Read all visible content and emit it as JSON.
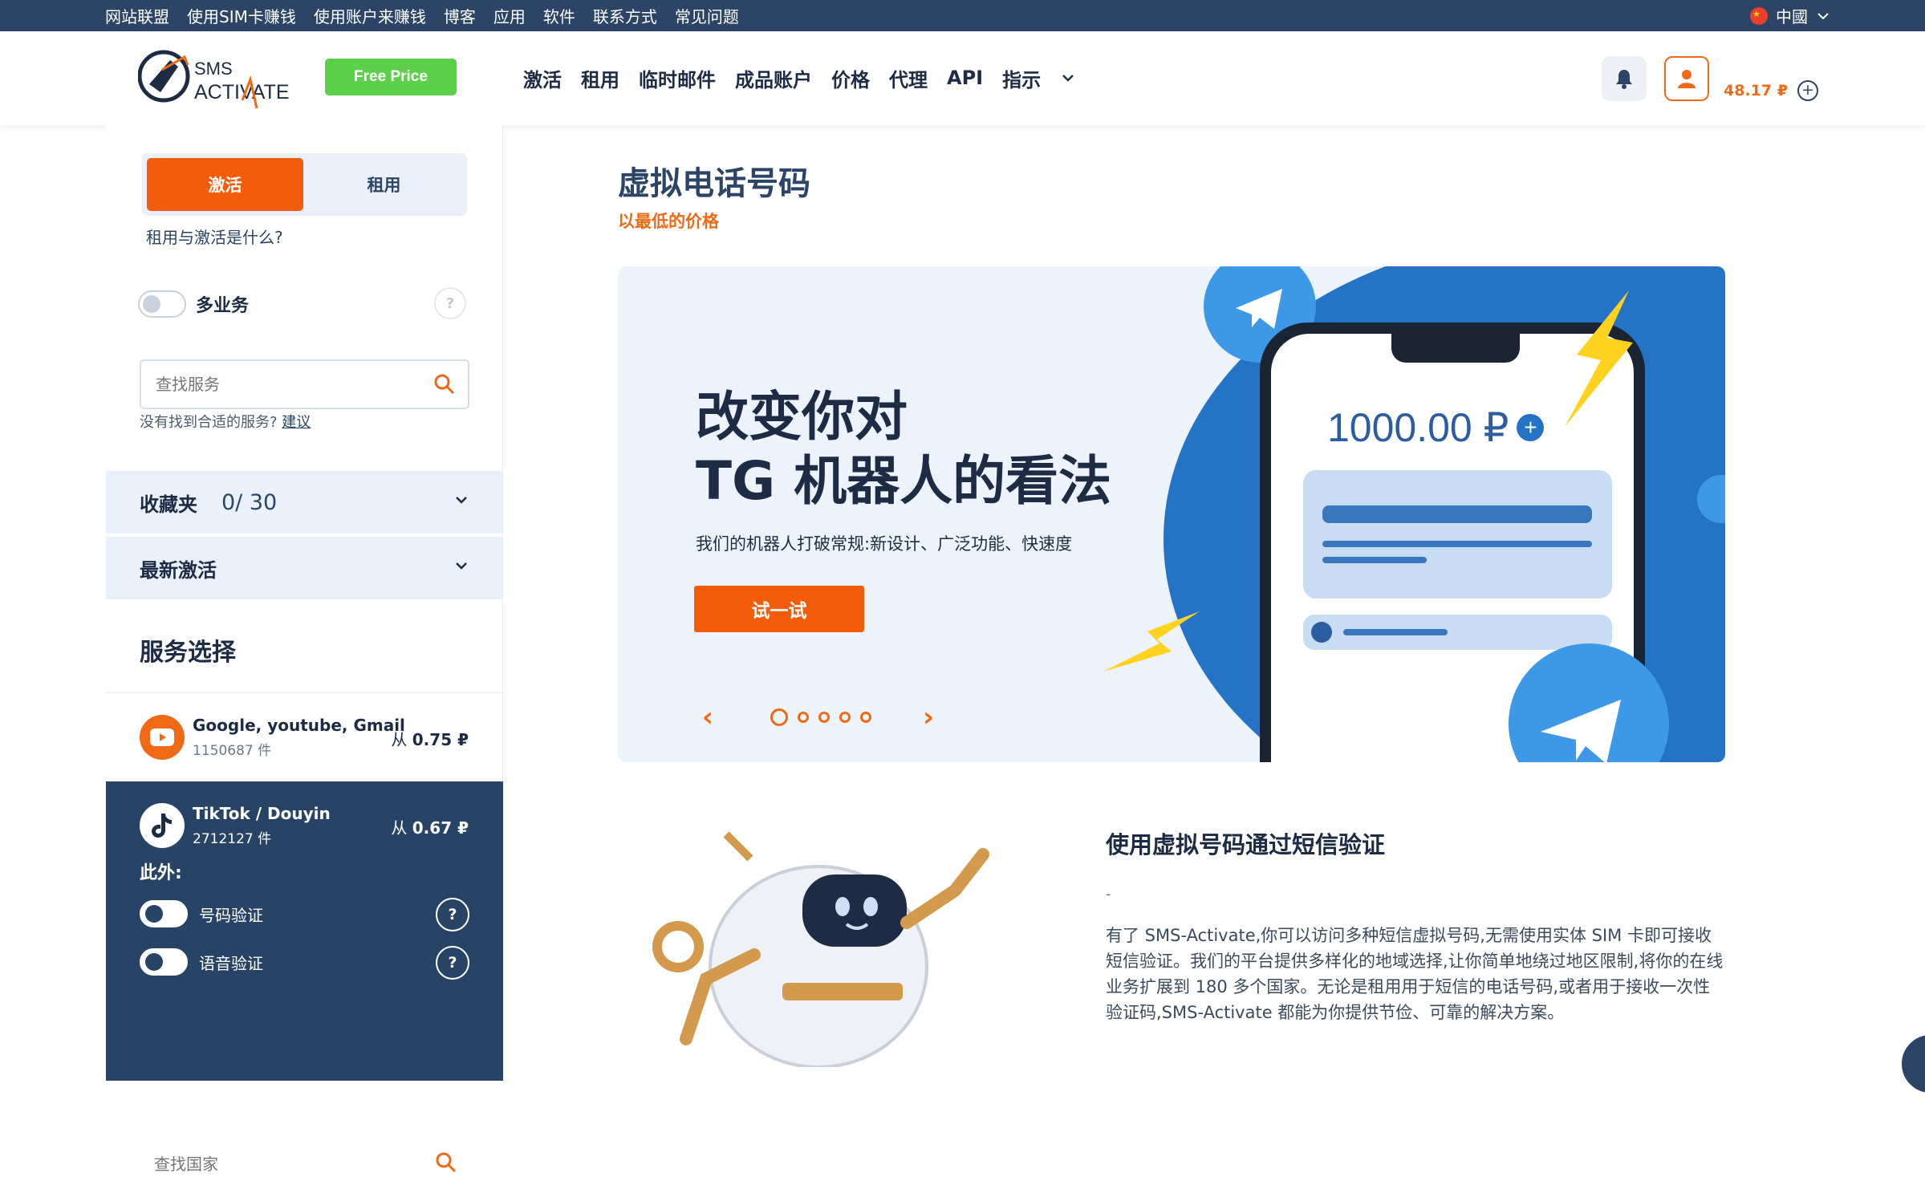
{
  "topbar": {
    "links": [
      "网站联盟",
      "使用SIM卡赚钱",
      "使用账户来赚钱",
      "博客",
      "应用",
      "软件",
      "联系方式",
      "常见问题"
    ],
    "language": "中國"
  },
  "header": {
    "logo_text_1": "SMS",
    "logo_text_2": "ACTIVATE",
    "free_price_label": "Free Price",
    "nav": [
      "激活",
      "租用",
      "临时邮件",
      "成品账户",
      "价格",
      "代理",
      "API",
      "指示"
    ],
    "balance": "48.17 ₽"
  },
  "sidebar": {
    "tab_activate": "激活",
    "tab_rent": "租用",
    "what_link": "租用与激活是什么?",
    "multi_service": "多业务",
    "search_placeholder": "查找服务",
    "not_found_text": "没有找到合适的服务?",
    "suggest_link": "建议",
    "favorites_label": "收藏夹",
    "favorites_count": "0/ 30",
    "recent_label": "最新激活",
    "service_select_title": "服务选择",
    "services": [
      {
        "name": "Google, youtube, Gmail",
        "count": "1150687 件",
        "price_prefix": "从",
        "price": "0.75 ₽"
      },
      {
        "name": "TikTok / Douyin",
        "count": "2712127 件",
        "price_prefix": "从",
        "price": "0.67 ₽"
      }
    ],
    "extra_label": "此外:",
    "number_verify": "号码验证",
    "voice_verify": "语音验证",
    "country_search_placeholder": "查找国家"
  },
  "main": {
    "title": "虚拟电话号码",
    "subtitle": "以最低的价格",
    "banner": {
      "headline_line1": "改变你对",
      "headline_line2": "TG 机器人的看法",
      "description": "我们的机器人打破常规:新设计、广泛功能、快速度",
      "cta": "试一试",
      "phone_amount": "1000.00 ₽"
    },
    "section2_title": "使用虚拟号码通过短信验证",
    "section2_dash": "-",
    "section2_body": "有了 SMS-Activate,你可以访问多种短信虚拟号码,无需使用实体 SIM 卡即可接收短信验证。我们的平台提供多样化的地域选择,让你简单地绕过地区限制,将你的在线业务扩展到 180 多个国家。无论是租用用于短信的电话号码,或者用于接收一次性验证码,SMS-Activate 都能为你提供节俭、可靠的解决方案。"
  },
  "colors": {
    "accent": "#f25c0b",
    "navy": "#2c4466",
    "green": "#5cd04a",
    "banner_blue": "#2473c6"
  }
}
